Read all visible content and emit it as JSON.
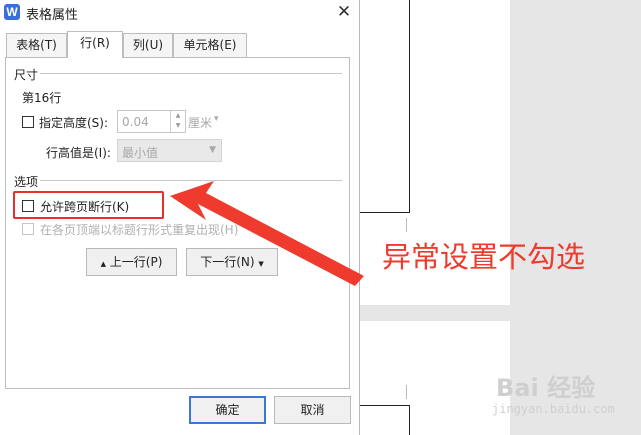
{
  "dialog": {
    "title": "表格属性",
    "app_icon_letter": "W",
    "close_glyph": "✕",
    "tabs": [
      {
        "label": "表格(T)",
        "active": false
      },
      {
        "label": "行(R)",
        "active": true
      },
      {
        "label": "列(U)",
        "active": false
      },
      {
        "label": "单元格(E)",
        "active": false
      }
    ],
    "size_section": {
      "label": "尺寸",
      "row_label": "第16行",
      "specify_height_label": "指定高度(S):",
      "specify_height_checked": false,
      "height_value": "0.04",
      "unit_label": "厘米",
      "row_height_mode_label": "行高值是(I):",
      "row_height_mode_value": "最小值"
    },
    "options_section": {
      "label": "选项",
      "allow_break_label": "允许跨页断行(K)",
      "allow_break_checked": false,
      "repeat_header_label": "在各页顶端以标题行形式重复出现(H)",
      "repeat_header_checked": false
    },
    "nav": {
      "prev_row_label": "上一行(P)",
      "next_row_label": "下一行(N)",
      "prev_icon": "▲",
      "next_icon": "▼"
    },
    "footer": {
      "ok_label": "确定",
      "cancel_label": "取消"
    }
  },
  "annotation": {
    "text": "异常设置不勾选",
    "color": "#ee3b2e"
  },
  "watermark": {
    "brand": "Bai 经验",
    "url": "jingyan.baidu.com"
  }
}
